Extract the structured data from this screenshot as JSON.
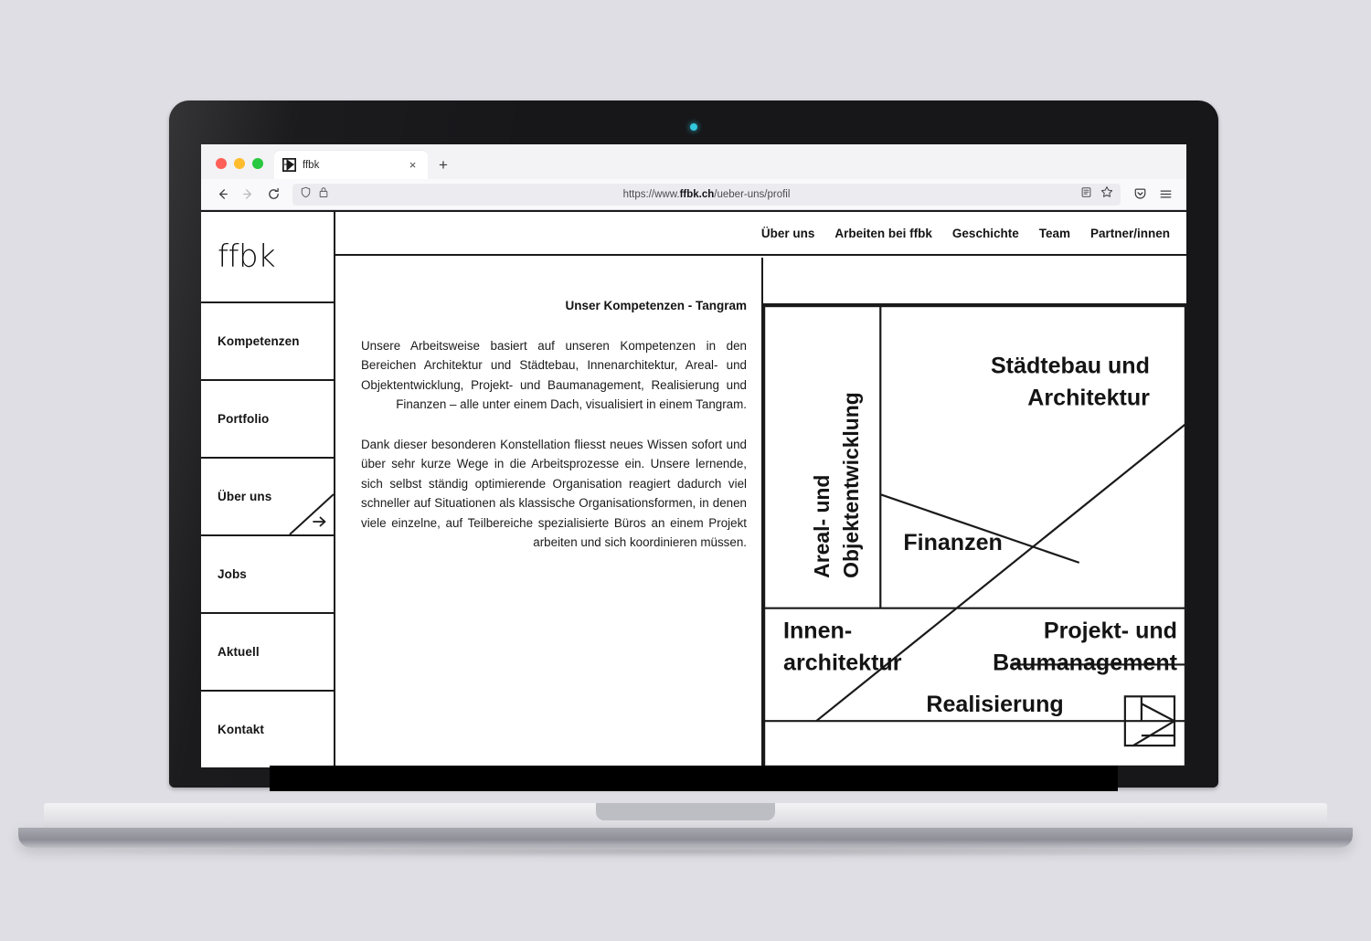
{
  "browser": {
    "tab": {
      "title": "ffbk",
      "favicon_name": "ffbk-tangram-favicon",
      "close_label": "×"
    },
    "newtab_label": "+",
    "nav": {
      "back_label": "←",
      "forward_label": "→",
      "reload_label": "↻"
    },
    "url": {
      "protocol": "https://www.",
      "domain": "ffbk.ch",
      "path": "/ueber-uns/profil",
      "full": "https://www.ffbk.ch/ueber-uns/profil",
      "shield_icon": "shield-icon",
      "lock_icon": "lock-icon"
    },
    "toolbar_icons": [
      "reader-mode-icon",
      "bookmark-star-icon",
      "pocket-icon",
      "menu-hamburger-icon"
    ],
    "traffic_lights": [
      "close-red",
      "minimize-yellow",
      "maximize-green"
    ]
  },
  "site": {
    "logo": "ffbk",
    "topnav": [
      {
        "label": "Über uns"
      },
      {
        "label": "Arbeiten bei ffbk"
      },
      {
        "label": "Geschichte"
      },
      {
        "label": "Team"
      },
      {
        "label": "Partner/innen"
      }
    ],
    "sidebar": [
      {
        "label": "Kompetenzen",
        "active": false
      },
      {
        "label": "Portfolio",
        "active": false
      },
      {
        "label": "Über uns",
        "active": true
      },
      {
        "label": "Jobs",
        "active": false
      },
      {
        "label": "Aktuell",
        "active": false
      },
      {
        "label": "Kontakt",
        "active": false
      }
    ],
    "content": {
      "kicker": "Unser Kompetenzen - Tangram",
      "paragraph1": "Unsere Arbeitsweise basiert auf unseren Kompetenzen in den Bereichen Architektur und Städtebau, Innenarchitektur, Areal- und Objektentwicklung, Projekt- und Baumanagement, Realisierung und Finanzen – alle unter einem Dach, visualisiert in einem Tangram.",
      "paragraph2": "Dank dieser besonderen Konstellation fliesst neues Wissen sofort und über sehr kurze Wege in die Arbeitsprozesse ein. Unsere lernende, sich selbst ständig optimierende Organisation reagiert dadurch viel schneller auf Situationen als klassische Organisationsformen, in denen viele einzelne, auf Teilbereiche spezialisierte Büros an einem Projekt arbeiten und sich koordinieren müssen."
    },
    "tangram": {
      "type": "diagram",
      "title": "Unser Kompetenzen - Tangram",
      "segments": [
        {
          "key": "areal",
          "label": "Areal- und\nObjektentwicklung",
          "line1": "Areal- und",
          "line2": "Objektentwicklung",
          "orientation": "vertical"
        },
        {
          "key": "staedtebau",
          "label": "Städtebau und\nArchitektur",
          "line1": "Städtebau und",
          "line2": "Architektur",
          "orientation": "horizontal"
        },
        {
          "key": "finanzen",
          "label": "Finanzen",
          "line1": "Finanzen",
          "line2": "",
          "orientation": "horizontal"
        },
        {
          "key": "projekt",
          "label": "Projekt- und\nBaumanagement",
          "line1": "Projekt- und",
          "line2": "Baumanagement",
          "orientation": "horizontal"
        },
        {
          "key": "innen",
          "label": "Innen-\narchitektur",
          "line1": "Innen-",
          "line2": "architektur",
          "orientation": "horizontal"
        },
        {
          "key": "realisierung",
          "label": "Realisierung",
          "line1": "Realisierung",
          "line2": "",
          "orientation": "horizontal"
        }
      ],
      "mark": "ffbk-tangram-mark"
    }
  },
  "colors": {
    "ink": "#1a1a1a",
    "page_bg": "#dedee4",
    "bezel": "#17171a",
    "webcam": "#32c8dd",
    "traffic_red": "#ff5f57",
    "traffic_yellow": "#ffbd2e",
    "traffic_green": "#28c840"
  }
}
